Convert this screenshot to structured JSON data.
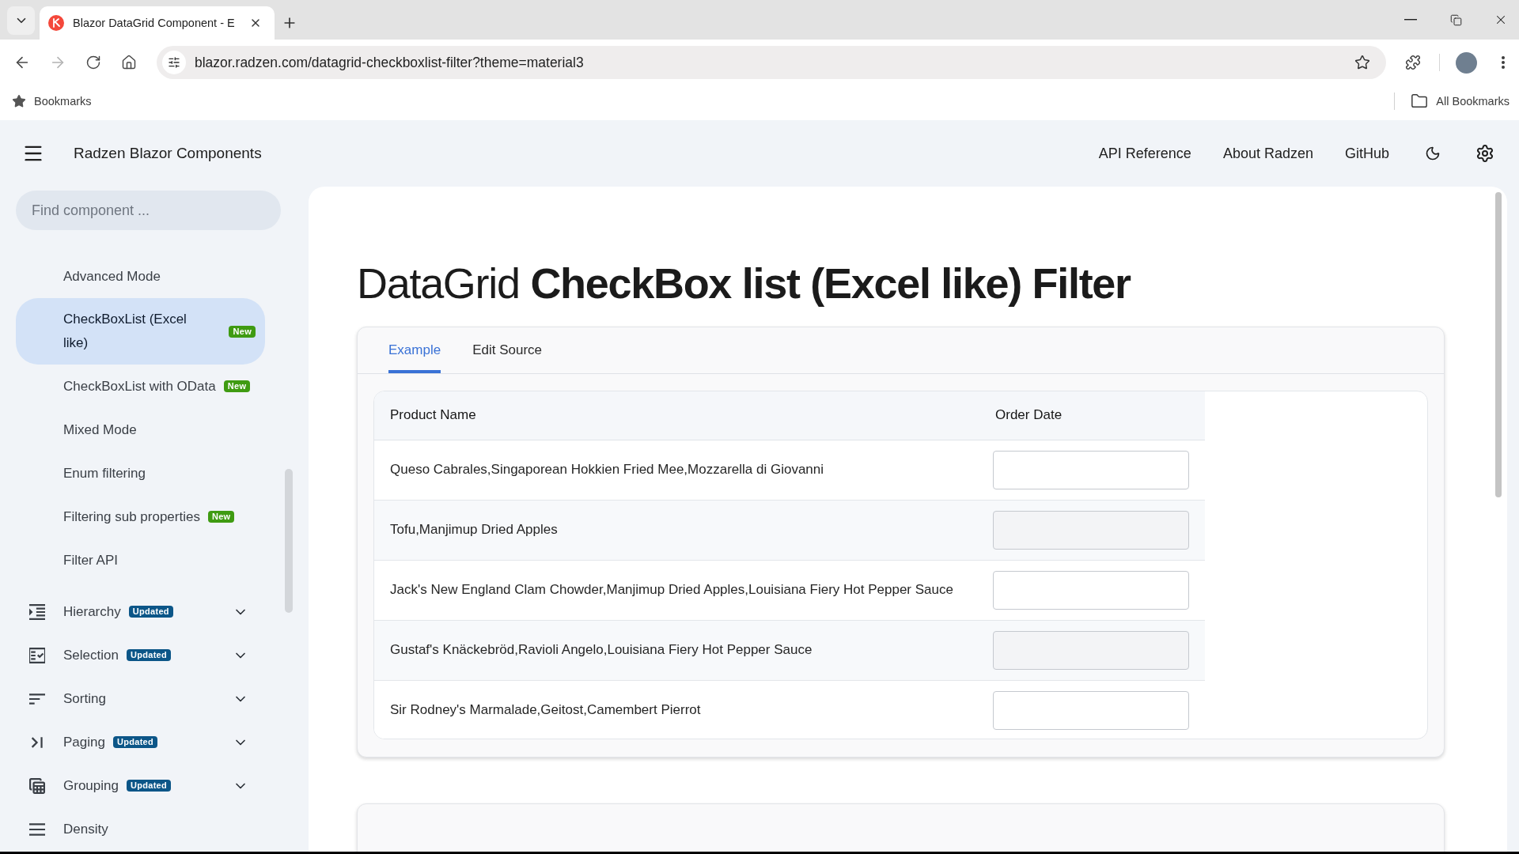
{
  "browser": {
    "tab": {
      "title": "Blazor DataGrid Component - E"
    },
    "forward_button": {
      "disabled": true
    },
    "url": "blazor.radzen.com/datagrid-checkboxlist-filter?theme=material3",
    "bookmarks": {
      "label": "Bookmarks",
      "all_label": "All Bookmarks"
    }
  },
  "header": {
    "title": "Radzen Blazor Components",
    "links": [
      "API Reference",
      "About Radzen",
      "GitHub"
    ]
  },
  "sidebar": {
    "search": {
      "placeholder": "Find component ..."
    },
    "items": [
      {
        "kind": "sub",
        "label": "Advanced Mode",
        "selected": false
      },
      {
        "kind": "sub",
        "label": "CheckBoxList (Excel like)",
        "selected": true,
        "badge": {
          "label": "New",
          "color": "#3f9b12"
        }
      },
      {
        "kind": "sub",
        "label": "CheckBoxList with OData",
        "selected": false,
        "badge": {
          "label": "New",
          "color": "#3f9b12"
        }
      },
      {
        "kind": "sub",
        "label": "Mixed Mode",
        "selected": false
      },
      {
        "kind": "sub",
        "label": "Enum filtering",
        "selected": false
      },
      {
        "kind": "sub",
        "label": "Filtering sub properties",
        "selected": false,
        "badge": {
          "label": "New",
          "color": "#3f9b12"
        }
      },
      {
        "kind": "sub",
        "label": "Filter API",
        "selected": false
      },
      {
        "kind": "group",
        "label": "Hierarchy",
        "selected": false,
        "badge": {
          "label": "Updated",
          "color": "#0c5688"
        }
      },
      {
        "kind": "group",
        "label": "Selection",
        "selected": false,
        "badge": {
          "label": "Updated",
          "color": "#0c5688"
        }
      },
      {
        "kind": "group",
        "label": "Sorting",
        "selected": false
      },
      {
        "kind": "group",
        "label": "Paging",
        "selected": false,
        "badge": {
          "label": "Updated",
          "color": "#0c5688"
        }
      },
      {
        "kind": "group",
        "label": "Grouping",
        "selected": false,
        "badge": {
          "label": "Updated",
          "color": "#0c5688"
        }
      },
      {
        "kind": "page",
        "label": "Density",
        "selected": false
      }
    ]
  },
  "page": {
    "title": "DataGrid **CheckBox list (Excel like) Filter**",
    "tabs": [
      {
        "label": "Example",
        "selected": true
      },
      {
        "label": "Edit Source",
        "selected": false
      }
    ],
    "grid": {
      "columns": [
        "Product Name",
        "Order Date"
      ],
      "rows": [
        {
          "product_name": "Queso Cabrales,Singaporean Hokkien Fried Mee,Mozzarella di Giovanni"
        },
        {
          "product_name": "Tofu,Manjimup Dried Apples"
        },
        {
          "product_name": "Jack's New England Clam Chowder,Manjimup Dried Apples,Louisiana Fiery Hot Pepper Sauce"
        },
        {
          "product_name": "Gustaf's Knäckebröd,Ravioli Angelo,Louisiana Fiery Hot Pepper Sauce"
        },
        {
          "product_name": "Sir Rodney's Marmalade,Geitost,Camembert Pierrot"
        }
      ]
    }
  }
}
